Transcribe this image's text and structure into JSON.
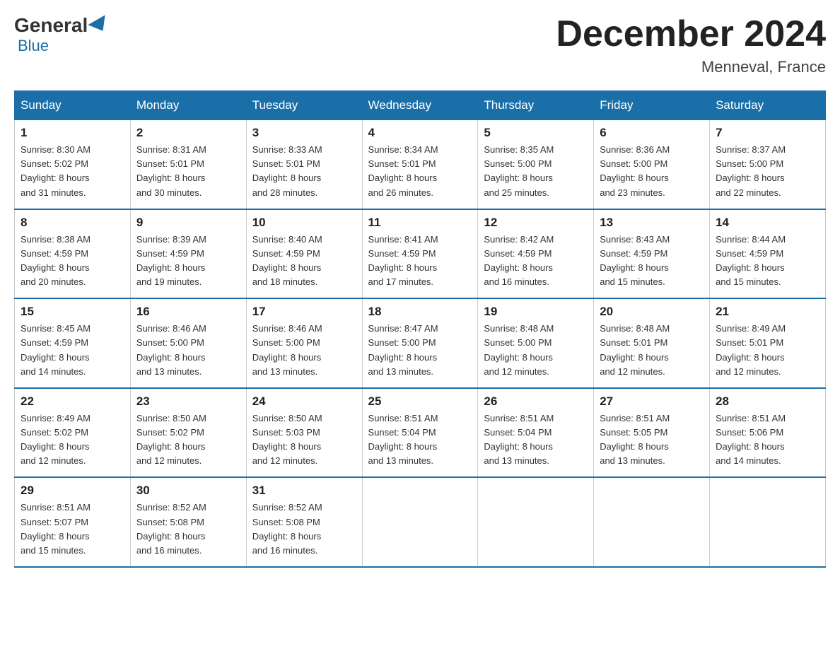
{
  "header": {
    "logo_general": "General",
    "logo_blue": "Blue",
    "title": "December 2024",
    "location": "Menneval, France"
  },
  "days_of_week": [
    "Sunday",
    "Monday",
    "Tuesday",
    "Wednesday",
    "Thursday",
    "Friday",
    "Saturday"
  ],
  "weeks": [
    [
      {
        "day": "1",
        "sunrise": "8:30 AM",
        "sunset": "5:02 PM",
        "daylight": "8 hours and 31 minutes."
      },
      {
        "day": "2",
        "sunrise": "8:31 AM",
        "sunset": "5:01 PM",
        "daylight": "8 hours and 30 minutes."
      },
      {
        "day": "3",
        "sunrise": "8:33 AM",
        "sunset": "5:01 PM",
        "daylight": "8 hours and 28 minutes."
      },
      {
        "day": "4",
        "sunrise": "8:34 AM",
        "sunset": "5:01 PM",
        "daylight": "8 hours and 26 minutes."
      },
      {
        "day": "5",
        "sunrise": "8:35 AM",
        "sunset": "5:00 PM",
        "daylight": "8 hours and 25 minutes."
      },
      {
        "day": "6",
        "sunrise": "8:36 AM",
        "sunset": "5:00 PM",
        "daylight": "8 hours and 23 minutes."
      },
      {
        "day": "7",
        "sunrise": "8:37 AM",
        "sunset": "5:00 PM",
        "daylight": "8 hours and 22 minutes."
      }
    ],
    [
      {
        "day": "8",
        "sunrise": "8:38 AM",
        "sunset": "4:59 PM",
        "daylight": "8 hours and 20 minutes."
      },
      {
        "day": "9",
        "sunrise": "8:39 AM",
        "sunset": "4:59 PM",
        "daylight": "8 hours and 19 minutes."
      },
      {
        "day": "10",
        "sunrise": "8:40 AM",
        "sunset": "4:59 PM",
        "daylight": "8 hours and 18 minutes."
      },
      {
        "day": "11",
        "sunrise": "8:41 AM",
        "sunset": "4:59 PM",
        "daylight": "8 hours and 17 minutes."
      },
      {
        "day": "12",
        "sunrise": "8:42 AM",
        "sunset": "4:59 PM",
        "daylight": "8 hours and 16 minutes."
      },
      {
        "day": "13",
        "sunrise": "8:43 AM",
        "sunset": "4:59 PM",
        "daylight": "8 hours and 15 minutes."
      },
      {
        "day": "14",
        "sunrise": "8:44 AM",
        "sunset": "4:59 PM",
        "daylight": "8 hours and 15 minutes."
      }
    ],
    [
      {
        "day": "15",
        "sunrise": "8:45 AM",
        "sunset": "4:59 PM",
        "daylight": "8 hours and 14 minutes."
      },
      {
        "day": "16",
        "sunrise": "8:46 AM",
        "sunset": "5:00 PM",
        "daylight": "8 hours and 13 minutes."
      },
      {
        "day": "17",
        "sunrise": "8:46 AM",
        "sunset": "5:00 PM",
        "daylight": "8 hours and 13 minutes."
      },
      {
        "day": "18",
        "sunrise": "8:47 AM",
        "sunset": "5:00 PM",
        "daylight": "8 hours and 13 minutes."
      },
      {
        "day": "19",
        "sunrise": "8:48 AM",
        "sunset": "5:00 PM",
        "daylight": "8 hours and 12 minutes."
      },
      {
        "day": "20",
        "sunrise": "8:48 AM",
        "sunset": "5:01 PM",
        "daylight": "8 hours and 12 minutes."
      },
      {
        "day": "21",
        "sunrise": "8:49 AM",
        "sunset": "5:01 PM",
        "daylight": "8 hours and 12 minutes."
      }
    ],
    [
      {
        "day": "22",
        "sunrise": "8:49 AM",
        "sunset": "5:02 PM",
        "daylight": "8 hours and 12 minutes."
      },
      {
        "day": "23",
        "sunrise": "8:50 AM",
        "sunset": "5:02 PM",
        "daylight": "8 hours and 12 minutes."
      },
      {
        "day": "24",
        "sunrise": "8:50 AM",
        "sunset": "5:03 PM",
        "daylight": "8 hours and 12 minutes."
      },
      {
        "day": "25",
        "sunrise": "8:51 AM",
        "sunset": "5:04 PM",
        "daylight": "8 hours and 13 minutes."
      },
      {
        "day": "26",
        "sunrise": "8:51 AM",
        "sunset": "5:04 PM",
        "daylight": "8 hours and 13 minutes."
      },
      {
        "day": "27",
        "sunrise": "8:51 AM",
        "sunset": "5:05 PM",
        "daylight": "8 hours and 13 minutes."
      },
      {
        "day": "28",
        "sunrise": "8:51 AM",
        "sunset": "5:06 PM",
        "daylight": "8 hours and 14 minutes."
      }
    ],
    [
      {
        "day": "29",
        "sunrise": "8:51 AM",
        "sunset": "5:07 PM",
        "daylight": "8 hours and 15 minutes."
      },
      {
        "day": "30",
        "sunrise": "8:52 AM",
        "sunset": "5:08 PM",
        "daylight": "8 hours and 16 minutes."
      },
      {
        "day": "31",
        "sunrise": "8:52 AM",
        "sunset": "5:08 PM",
        "daylight": "8 hours and 16 minutes."
      },
      null,
      null,
      null,
      null
    ]
  ],
  "labels": {
    "sunrise": "Sunrise:",
    "sunset": "Sunset:",
    "daylight": "Daylight:"
  }
}
